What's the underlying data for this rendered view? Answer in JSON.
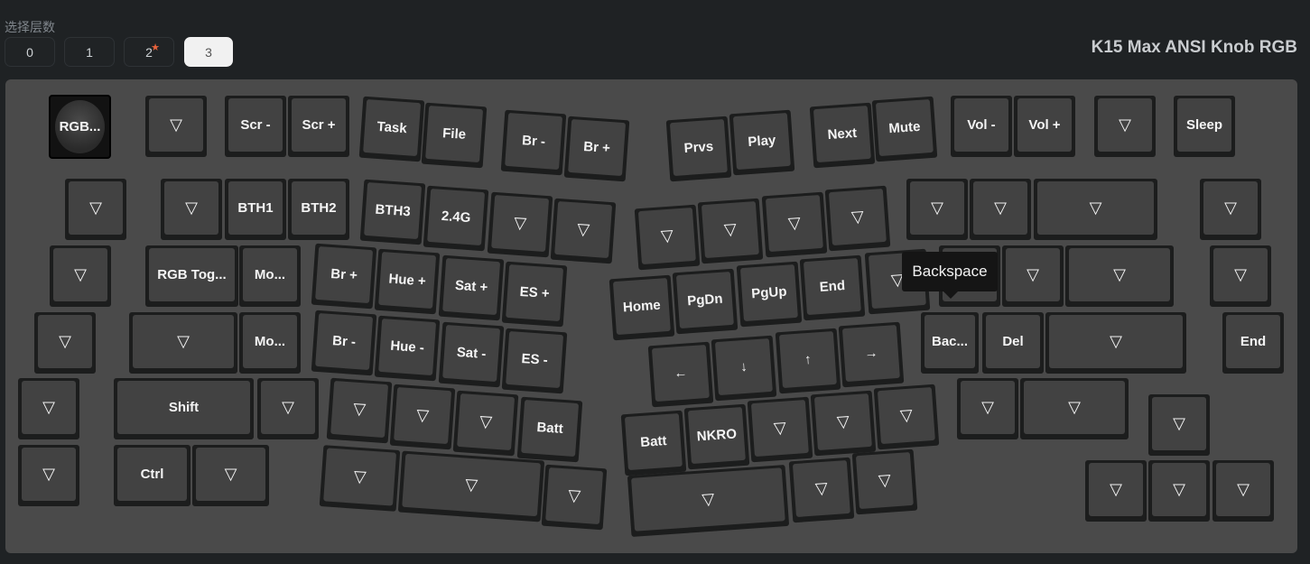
{
  "layer_selector": {
    "label": "选择层数",
    "layers": [
      "0",
      "1",
      "2",
      "3"
    ],
    "active": "3",
    "starred": "2"
  },
  "keyboard_name": "K15 Max ANSI Knob RGB",
  "tooltip": "Backspace",
  "empty_key_icon": "▽",
  "colors": {
    "background": "#1f2224",
    "board": "#4a4a4a",
    "keycap": "#424242",
    "star": "#e8623b"
  },
  "keys": [
    {
      "id": "knob",
      "label": "RGB..."
    },
    {
      "id": "r0k1",
      "label": "▽"
    },
    {
      "id": "r0k2",
      "label": "Scr -"
    },
    {
      "id": "r0k3",
      "label": "Scr +"
    },
    {
      "id": "r0k4",
      "label": "Task"
    },
    {
      "id": "r0k5",
      "label": "File"
    },
    {
      "id": "r0k6",
      "label": "Br -"
    },
    {
      "id": "r0k7",
      "label": "Br +"
    },
    {
      "id": "r0k8",
      "label": "Prvs"
    },
    {
      "id": "r0k9",
      "label": "Play"
    },
    {
      "id": "r0k10",
      "label": "Next"
    },
    {
      "id": "r0k11",
      "label": "Mute"
    },
    {
      "id": "r0k12",
      "label": "Vol -"
    },
    {
      "id": "r0k13",
      "label": "Vol +"
    },
    {
      "id": "r0k14",
      "label": "▽"
    },
    {
      "id": "r0k15",
      "label": "Sleep"
    },
    {
      "id": "r1k0",
      "label": "▽"
    },
    {
      "id": "r1k1",
      "label": "▽"
    },
    {
      "id": "r1k2",
      "label": "BTH1"
    },
    {
      "id": "r1k3",
      "label": "BTH2"
    },
    {
      "id": "r1k4",
      "label": "BTH3"
    },
    {
      "id": "r1k5",
      "label": "2.4G"
    },
    {
      "id": "r1k6",
      "label": "▽"
    },
    {
      "id": "r1k7",
      "label": "▽"
    },
    {
      "id": "r1k8",
      "label": "▽"
    },
    {
      "id": "r1k9",
      "label": "▽"
    },
    {
      "id": "r1k10",
      "label": "▽"
    },
    {
      "id": "r1k11",
      "label": "▽"
    },
    {
      "id": "r1k12",
      "label": "▽"
    },
    {
      "id": "r1k13",
      "label": "▽"
    },
    {
      "id": "r1k14",
      "label": "▽"
    },
    {
      "id": "r1k15",
      "label": "▽"
    },
    {
      "id": "r2k0",
      "label": "▽"
    },
    {
      "id": "r2k1",
      "label": "RGB Tog..."
    },
    {
      "id": "r2k2",
      "label": "Mo..."
    },
    {
      "id": "r2k3",
      "label": "Br +"
    },
    {
      "id": "r2k4",
      "label": "Hue +"
    },
    {
      "id": "r2k5",
      "label": "Sat +"
    },
    {
      "id": "r2k6",
      "label": "ES +"
    },
    {
      "id": "r2k7",
      "label": "Home"
    },
    {
      "id": "r2k8",
      "label": "PgDn"
    },
    {
      "id": "r2k9",
      "label": "PgUp"
    },
    {
      "id": "r2k10",
      "label": "End"
    },
    {
      "id": "r2k11",
      "label": "▽"
    },
    {
      "id": "r2k12",
      "label": "▽"
    },
    {
      "id": "r2k13",
      "label": "▽"
    },
    {
      "id": "r2k14",
      "label": "▽"
    },
    {
      "id": "r2k15",
      "label": "▽"
    },
    {
      "id": "r3k0",
      "label": "▽"
    },
    {
      "id": "r3k1",
      "label": "▽"
    },
    {
      "id": "r3k2",
      "label": "Mo..."
    },
    {
      "id": "r3k3",
      "label": "Br -"
    },
    {
      "id": "r3k4",
      "label": "Hue -"
    },
    {
      "id": "r3k5",
      "label": "Sat -"
    },
    {
      "id": "r3k6",
      "label": "ES -"
    },
    {
      "id": "r3k7",
      "label": "←"
    },
    {
      "id": "r3k8",
      "label": "↓"
    },
    {
      "id": "r3k9",
      "label": "↑"
    },
    {
      "id": "r3k10",
      "label": "→"
    },
    {
      "id": "r3k11",
      "label": "Bac..."
    },
    {
      "id": "r3k12",
      "label": "Del"
    },
    {
      "id": "r3k13",
      "label": "▽"
    },
    {
      "id": "r3k14",
      "label": "End"
    },
    {
      "id": "r4k0",
      "label": "▽"
    },
    {
      "id": "r4k1",
      "label": "Shift"
    },
    {
      "id": "r4k2",
      "label": "▽"
    },
    {
      "id": "r4k3",
      "label": "▽"
    },
    {
      "id": "r4k4",
      "label": "▽"
    },
    {
      "id": "r4k5",
      "label": "▽"
    },
    {
      "id": "r4k6",
      "label": "Batt"
    },
    {
      "id": "r4k7",
      "label": "Batt"
    },
    {
      "id": "r4k8",
      "label": "NKRO"
    },
    {
      "id": "r4k9",
      "label": "▽"
    },
    {
      "id": "r4k10",
      "label": "▽"
    },
    {
      "id": "r4k11",
      "label": "▽"
    },
    {
      "id": "r4k12",
      "label": "▽"
    },
    {
      "id": "r4k13",
      "label": "▽"
    },
    {
      "id": "r4k14",
      "label": "▽"
    },
    {
      "id": "r5k0",
      "label": "▽"
    },
    {
      "id": "r5k1",
      "label": "Ctrl"
    },
    {
      "id": "r5k2",
      "label": "▽"
    },
    {
      "id": "r5k3",
      "label": "▽"
    },
    {
      "id": "r5k4",
      "label": "▽"
    },
    {
      "id": "r5k5",
      "label": "▽"
    },
    {
      "id": "r5k6",
      "label": "▽"
    },
    {
      "id": "r5k7",
      "label": "▽"
    },
    {
      "id": "r5k8",
      "label": "▽"
    },
    {
      "id": "r5k9",
      "label": "▽"
    },
    {
      "id": "r5k10",
      "label": "▽"
    },
    {
      "id": "r5k11",
      "label": "▽"
    }
  ]
}
